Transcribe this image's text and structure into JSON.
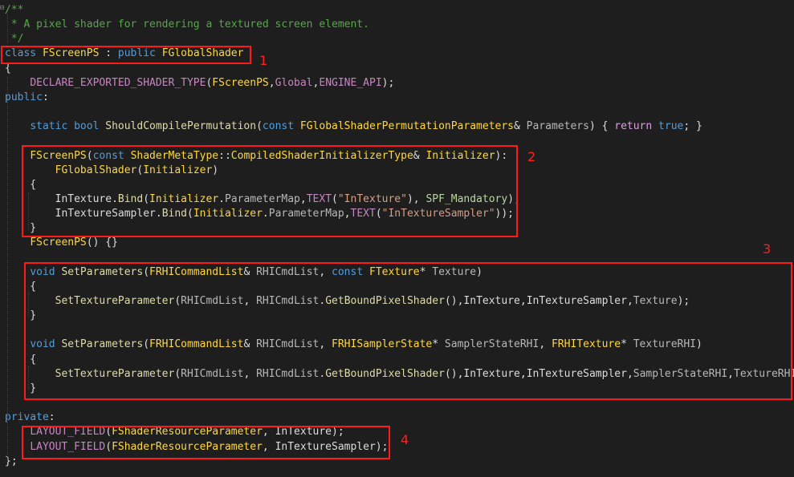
{
  "annotations": {
    "box1_label": "1",
    "box2_label": "2",
    "box3_label": "3",
    "box4_label": "4",
    "box_color": "#ff1a1a"
  },
  "lines": [
    [
      [
        "/**",
        "cm"
      ]
    ],
    [
      [
        " * A pixel shader for rendering a textured screen element.",
        "cm"
      ]
    ],
    [
      [
        " */",
        "cm"
      ]
    ],
    [
      [
        "class",
        "kw"
      ],
      [
        " ",
        "pl"
      ],
      [
        "FScreenPS",
        "type"
      ],
      [
        " : ",
        "pl"
      ],
      [
        "public",
        "kw"
      ],
      [
        " ",
        "pl"
      ],
      [
        "FGlobalShader",
        "type"
      ]
    ],
    [
      [
        "{",
        "pl"
      ]
    ],
    [
      [
        "    ",
        "pl"
      ],
      [
        "DECLARE_EXPORTED_SHADER_TYPE",
        "mac"
      ],
      [
        "(",
        "pl"
      ],
      [
        "FScreenPS",
        "type"
      ],
      [
        ",",
        "pl"
      ],
      [
        "Global",
        "mac"
      ],
      [
        ",",
        "pl"
      ],
      [
        "ENGINE_API",
        "mac"
      ],
      [
        ");",
        "pl"
      ]
    ],
    [
      [
        "public",
        "kw"
      ],
      [
        ":",
        "pl"
      ]
    ],
    [],
    [
      [
        "    ",
        "pl"
      ],
      [
        "static",
        "kw"
      ],
      [
        " ",
        "pl"
      ],
      [
        "bool",
        "kw"
      ],
      [
        " ",
        "pl"
      ],
      [
        "ShouldCompilePermutation",
        "fn"
      ],
      [
        "(",
        "pl"
      ],
      [
        "const",
        "kw"
      ],
      [
        " ",
        "pl"
      ],
      [
        "FGlobalShaderPermutationParameters",
        "type"
      ],
      [
        "& ",
        "pl"
      ],
      [
        "Parameters",
        "gr"
      ],
      [
        ") { ",
        "pl"
      ],
      [
        "return",
        "ctrl"
      ],
      [
        " ",
        "pl"
      ],
      [
        "true",
        "kw"
      ],
      [
        "; }",
        "pl"
      ]
    ],
    [],
    [
      [
        "    ",
        "pl"
      ],
      [
        "FScreenPS",
        "type"
      ],
      [
        "(",
        "pl"
      ],
      [
        "const",
        "kw"
      ],
      [
        " ",
        "pl"
      ],
      [
        "ShaderMetaType",
        "type"
      ],
      [
        "::",
        "pl"
      ],
      [
        "CompiledShaderInitializerType",
        "type"
      ],
      [
        "& ",
        "pl"
      ],
      [
        "Initializer",
        "type"
      ],
      [
        "):",
        "pl"
      ]
    ],
    [
      [
        "        ",
        "pl"
      ],
      [
        "FGlobalShader",
        "type"
      ],
      [
        "(",
        "pl"
      ],
      [
        "Initializer",
        "type"
      ],
      [
        ")",
        "pl"
      ]
    ],
    [
      [
        "    {",
        "pl"
      ]
    ],
    [
      [
        "        ",
        "pl"
      ],
      [
        "InTexture",
        "id"
      ],
      [
        ".",
        "pl"
      ],
      [
        "Bind",
        "fn"
      ],
      [
        "(",
        "pl"
      ],
      [
        "Initializer",
        "type"
      ],
      [
        ".",
        "pl"
      ],
      [
        "ParameterMap",
        "gr"
      ],
      [
        ",",
        "pl"
      ],
      [
        "TEXT",
        "mac"
      ],
      [
        "(",
        "pl"
      ],
      [
        "\"InTexture\"",
        "str"
      ],
      [
        "), ",
        "pl"
      ],
      [
        "SPF_Mandatory",
        "en"
      ],
      [
        ");",
        "pl"
      ]
    ],
    [
      [
        "        ",
        "pl"
      ],
      [
        "InTextureSampler",
        "id"
      ],
      [
        ".",
        "pl"
      ],
      [
        "Bind",
        "fn"
      ],
      [
        "(",
        "pl"
      ],
      [
        "Initializer",
        "type"
      ],
      [
        ".",
        "pl"
      ],
      [
        "ParameterMap",
        "gr"
      ],
      [
        ",",
        "pl"
      ],
      [
        "TEXT",
        "mac"
      ],
      [
        "(",
        "pl"
      ],
      [
        "\"InTextureSampler\"",
        "str"
      ],
      [
        "));",
        "pl"
      ]
    ],
    [
      [
        "    }",
        "pl"
      ]
    ],
    [
      [
        "    ",
        "pl"
      ],
      [
        "FScreenPS",
        "type"
      ],
      [
        "() {}",
        "pl"
      ]
    ],
    [],
    [
      [
        "    ",
        "pl"
      ],
      [
        "void",
        "kw"
      ],
      [
        " ",
        "pl"
      ],
      [
        "SetParameters",
        "fn"
      ],
      [
        "(",
        "pl"
      ],
      [
        "FRHICommandList",
        "type"
      ],
      [
        "& ",
        "pl"
      ],
      [
        "RHICmdList",
        "gr"
      ],
      [
        ", ",
        "pl"
      ],
      [
        "const",
        "kw"
      ],
      [
        " ",
        "pl"
      ],
      [
        "FTexture",
        "type"
      ],
      [
        "* ",
        "pl"
      ],
      [
        "Texture",
        "gr"
      ],
      [
        ")",
        "pl"
      ]
    ],
    [
      [
        "    {",
        "pl"
      ]
    ],
    [
      [
        "        ",
        "pl"
      ],
      [
        "SetTextureParameter",
        "fn"
      ],
      [
        "(",
        "pl"
      ],
      [
        "RHICmdList",
        "gr"
      ],
      [
        ", ",
        "pl"
      ],
      [
        "RHICmdList",
        "gr"
      ],
      [
        ".",
        "pl"
      ],
      [
        "GetBoundPixelShader",
        "fn"
      ],
      [
        "(),",
        "pl"
      ],
      [
        "InTexture",
        "id"
      ],
      [
        ",",
        "pl"
      ],
      [
        "InTextureSampler",
        "id"
      ],
      [
        ",",
        "pl"
      ],
      [
        "Texture",
        "gr"
      ],
      [
        ");",
        "pl"
      ]
    ],
    [
      [
        "    }",
        "pl"
      ]
    ],
    [],
    [
      [
        "    ",
        "pl"
      ],
      [
        "void",
        "kw"
      ],
      [
        " ",
        "pl"
      ],
      [
        "SetParameters",
        "fn"
      ],
      [
        "(",
        "pl"
      ],
      [
        "FRHICommandList",
        "type"
      ],
      [
        "& ",
        "pl"
      ],
      [
        "RHICmdList",
        "gr"
      ],
      [
        ", ",
        "pl"
      ],
      [
        "FRHISamplerState",
        "type"
      ],
      [
        "* ",
        "pl"
      ],
      [
        "SamplerStateRHI",
        "gr"
      ],
      [
        ", ",
        "pl"
      ],
      [
        "FRHITexture",
        "type"
      ],
      [
        "* ",
        "pl"
      ],
      [
        "TextureRHI",
        "gr"
      ],
      [
        ")",
        "pl"
      ]
    ],
    [
      [
        "    {",
        "pl"
      ]
    ],
    [
      [
        "        ",
        "pl"
      ],
      [
        "SetTextureParameter",
        "fn"
      ],
      [
        "(",
        "pl"
      ],
      [
        "RHICmdList",
        "gr"
      ],
      [
        ", ",
        "pl"
      ],
      [
        "RHICmdList",
        "gr"
      ],
      [
        ".",
        "pl"
      ],
      [
        "GetBoundPixelShader",
        "fn"
      ],
      [
        "(),",
        "pl"
      ],
      [
        "InTexture",
        "id"
      ],
      [
        ",",
        "pl"
      ],
      [
        "InTextureSampler",
        "id"
      ],
      [
        ",",
        "pl"
      ],
      [
        "SamplerStateRHI",
        "gr"
      ],
      [
        ",",
        "pl"
      ],
      [
        "TextureRHI",
        "gr"
      ],
      [
        ");",
        "pl"
      ]
    ],
    [
      [
        "    }",
        "pl"
      ]
    ],
    [],
    [
      [
        "private",
        "kw"
      ],
      [
        ":",
        "pl"
      ]
    ],
    [
      [
        "    ",
        "pl"
      ],
      [
        "LAYOUT_FIELD",
        "mac"
      ],
      [
        "(",
        "pl"
      ],
      [
        "FShaderResourceParameter",
        "type"
      ],
      [
        ", ",
        "pl"
      ],
      [
        "InTexture",
        "id"
      ],
      [
        ");",
        "pl"
      ]
    ],
    [
      [
        "    ",
        "pl"
      ],
      [
        "LAYOUT_FIELD",
        "mac"
      ],
      [
        "(",
        "pl"
      ],
      [
        "FShaderResourceParameter",
        "type"
      ],
      [
        ", ",
        "pl"
      ],
      [
        "InTextureSampler",
        "id"
      ],
      [
        ");",
        "pl"
      ]
    ],
    [
      [
        "};",
        "pl"
      ]
    ]
  ]
}
